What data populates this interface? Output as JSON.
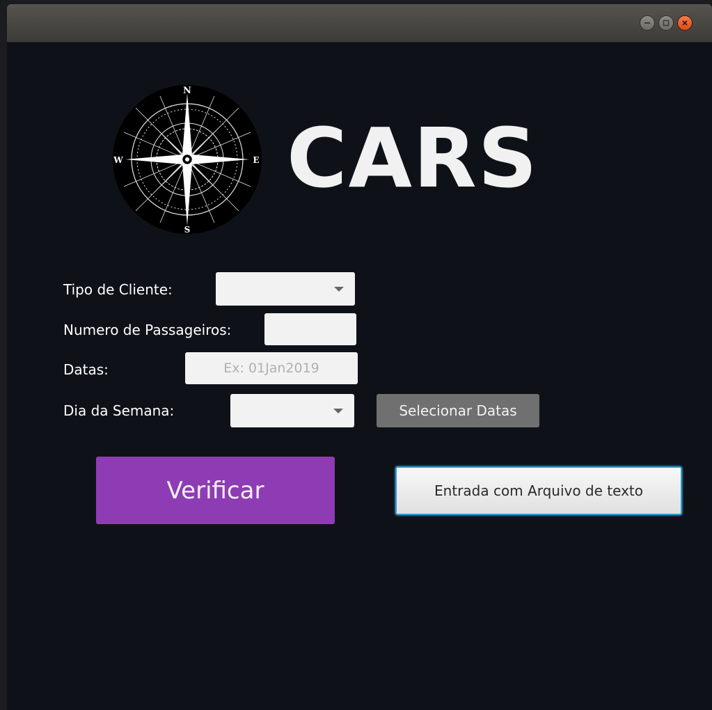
{
  "window": {
    "controls": {
      "minimize_icon": "minimize-icon",
      "maximize_icon": "maximize-icon",
      "close_icon": "close-icon"
    }
  },
  "header": {
    "logo_icon": "compass-rose-icon",
    "compass_points": {
      "n": "N",
      "e": "E",
      "s": "S",
      "w": "W"
    },
    "title": "CARS"
  },
  "form": {
    "client_type": {
      "label": "Tipo de Cliente:",
      "value": ""
    },
    "passengers": {
      "label": "Numero de Passageiros:",
      "value": ""
    },
    "dates": {
      "label": "Datas:",
      "value": "",
      "placeholder": "Ex: 01Jan2019"
    },
    "weekday": {
      "label": "Dia da Semana:",
      "value": ""
    },
    "select_dates_label": "Selecionar Datas"
  },
  "actions": {
    "verify_label": "Verificar",
    "file_input_label": "Entrada com Arquivo de texto"
  },
  "colors": {
    "background": "#0e1218",
    "verify_button": "#8e3cb4",
    "select_dates_button": "#707070",
    "focus_ring": "#2b9bd2",
    "close_button": "#df4b16"
  }
}
